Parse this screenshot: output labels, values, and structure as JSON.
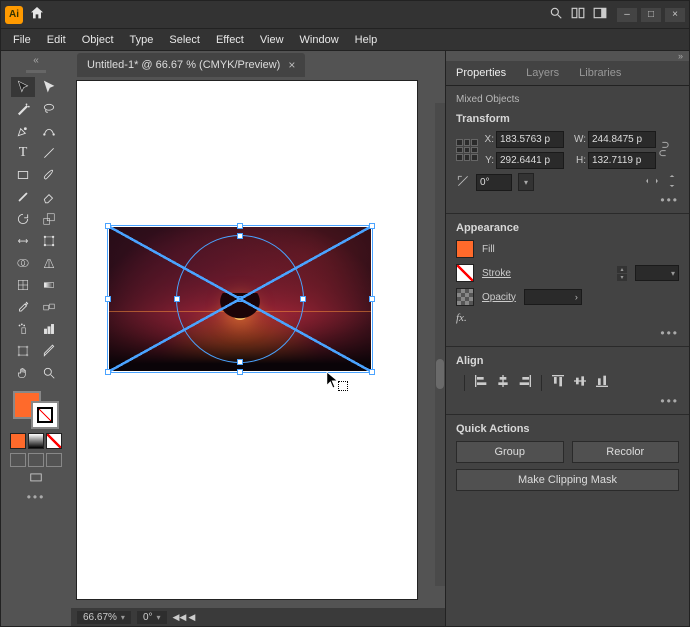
{
  "app": {
    "badge": "Ai"
  },
  "menus": [
    "File",
    "Edit",
    "Object",
    "Type",
    "Select",
    "Effect",
    "View",
    "Window",
    "Help"
  ],
  "document": {
    "tab_title": "Untitled-1* @ 66.67 % (CMYK/Preview)",
    "tab_close": "×"
  },
  "status": {
    "zoom": "66.67%",
    "rotation": "0°"
  },
  "panels": {
    "tabs": {
      "properties": "Properties",
      "layers": "Layers",
      "libraries": "Libraries"
    },
    "selection": "Mixed Objects",
    "transform": {
      "title": "Transform",
      "x_label": "X:",
      "x_value": "183.5763 p",
      "y_label": "Y:",
      "y_value": "292.6441 p",
      "w_label": "W:",
      "w_value": "244.8475 p",
      "h_label": "H:",
      "h_value": "132.7119 p",
      "rotate_value": "0°"
    },
    "appearance": {
      "title": "Appearance",
      "fill": "Fill",
      "stroke": "Stroke",
      "opacity": "Opacity",
      "fx": "fx."
    },
    "align": {
      "title": "Align"
    },
    "quick": {
      "title": "Quick Actions",
      "group": "Group",
      "recolor": "Recolor",
      "mask": "Make Clipping Mask"
    }
  },
  "more": "•••"
}
